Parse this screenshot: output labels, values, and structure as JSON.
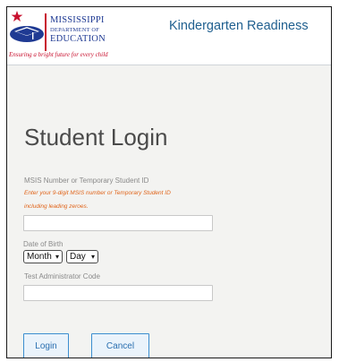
{
  "header": {
    "logo": {
      "line1": "MISSISSIPPI",
      "line2": "DEPARTMENT OF",
      "line3": "EDUCATION",
      "tagline": "Ensuring a bright future for every child"
    },
    "app_title": "Kindergarten Readiness"
  },
  "login": {
    "title": "Student Login",
    "msis_label": "MSIS Number or Temporary Student ID",
    "msis_hint_line1": "Enter your 9-digit MSIS number or Temporary Student ID",
    "msis_hint_line2": "including leading zeroes.",
    "msis_value": "",
    "dob_label": "Date of Birth",
    "month_select": "Month",
    "day_select": "Day",
    "admin_code_label": "Test Administrator Code",
    "admin_code_value": "",
    "login_button": "Login",
    "cancel_button": "Cancel"
  },
  "colors": {
    "brand_blue": "#1f5f8f",
    "accent_red": "#c8102e",
    "hint_orange": "#e0641a",
    "button_border": "#3b8ed0"
  }
}
